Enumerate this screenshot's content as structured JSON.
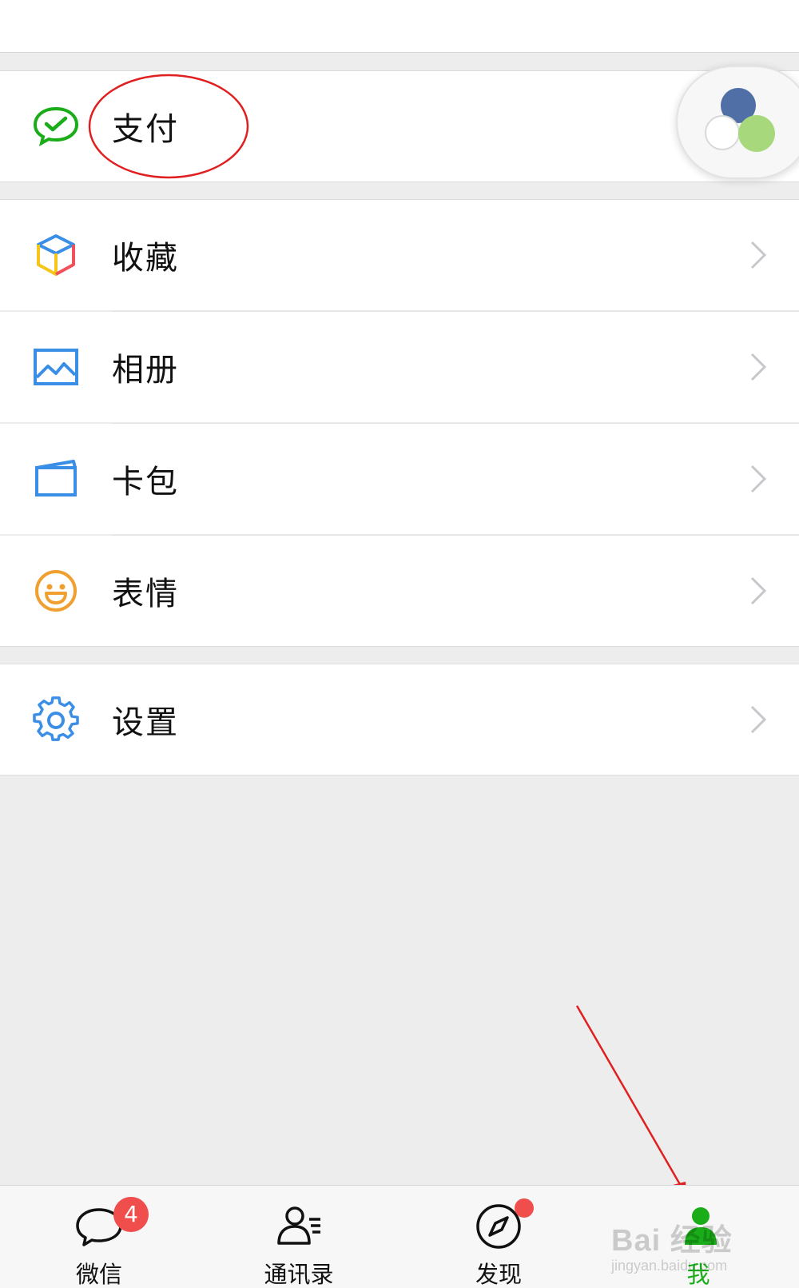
{
  "menu": {
    "pay": {
      "label": "支付"
    },
    "items": [
      {
        "label": "收藏"
      },
      {
        "label": "相册"
      },
      {
        "label": "卡包"
      },
      {
        "label": "表情"
      }
    ],
    "settings": {
      "label": "设置"
    }
  },
  "tabbar": {
    "tabs": [
      {
        "label": "微信",
        "badge": "4"
      },
      {
        "label": "通讯录"
      },
      {
        "label": "发现"
      },
      {
        "label": "我"
      }
    ],
    "active": "我"
  },
  "watermark": {
    "main": "Bai 经验",
    "sub": "jingyan.baidu.com"
  },
  "colors": {
    "accent_green": "#1aad19",
    "badge_red": "#f04d4d",
    "annotation_red": "#e02020",
    "background": "#ededed"
  },
  "icons": {
    "pay": "wechat-pay-icon",
    "favorites": "cube-icon",
    "album": "picture-icon",
    "cards": "card-wallet-icon",
    "stickers": "smiley-icon",
    "settings": "gear-icon",
    "chats": "chat-bubble-icon",
    "contacts": "contacts-icon",
    "discover": "compass-icon",
    "me": "person-icon"
  }
}
